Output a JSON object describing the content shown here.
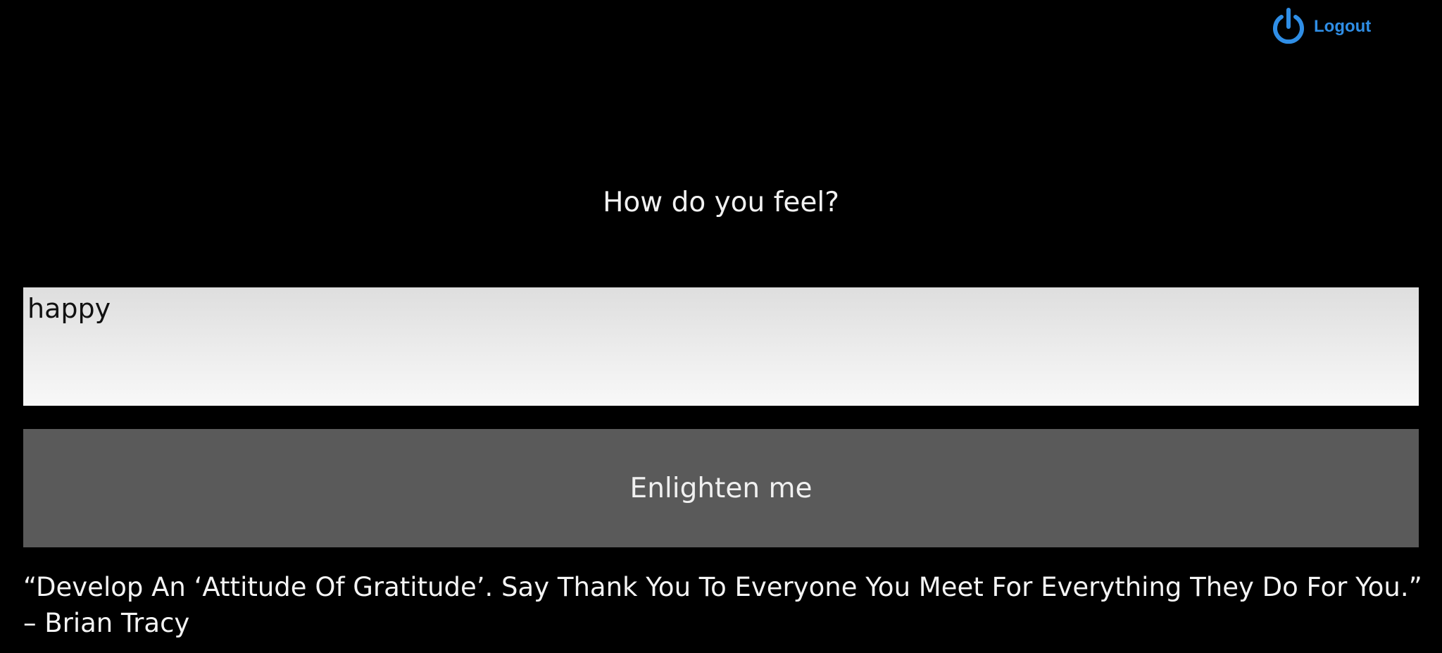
{
  "header": {
    "logout_label": "Logout",
    "logout_icon": "power-icon",
    "accent_color": "#2f8ee6"
  },
  "main": {
    "prompt": "How do you feel?",
    "mood_input": {
      "value": "happy",
      "placeholder": ""
    },
    "submit_label": "Enlighten me"
  },
  "quote": {
    "text": "“Develop An ‘Attitude Of Gratitude’. Say Thank You To Everyone You Meet For Everything They Do For You.”",
    "author": "– Brian Tracy"
  }
}
